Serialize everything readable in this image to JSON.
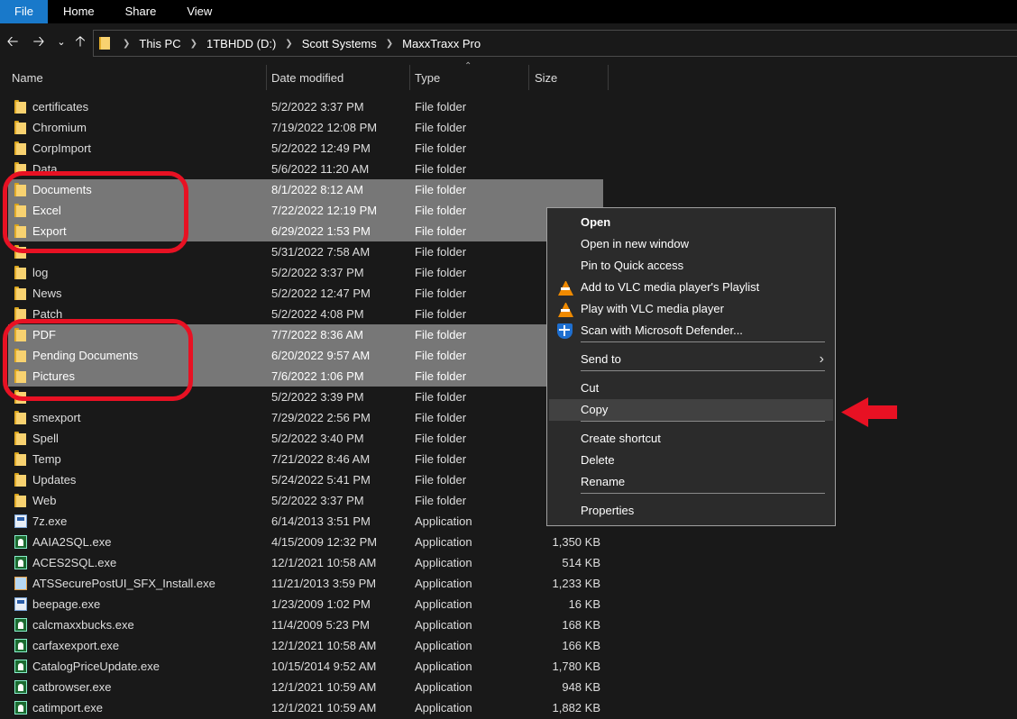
{
  "ribbon": {
    "tabs": [
      "File",
      "Home",
      "Share",
      "View"
    ]
  },
  "address": {
    "crumbs": [
      "This PC",
      "1TBHDD (D:)",
      "Scott Systems",
      "MaxxTraxx Pro"
    ]
  },
  "columns": {
    "name": "Name",
    "date": "Date modified",
    "type": "Type",
    "size": "Size"
  },
  "files": [
    {
      "name": "certificates",
      "date": "5/2/2022 3:37 PM",
      "type": "File folder",
      "size": "",
      "icon": "folder",
      "selected": false
    },
    {
      "name": "Chromium",
      "date": "7/19/2022 12:08 PM",
      "type": "File folder",
      "size": "",
      "icon": "folder",
      "selected": false
    },
    {
      "name": "CorpImport",
      "date": "5/2/2022 12:49 PM",
      "type": "File folder",
      "size": "",
      "icon": "folder",
      "selected": false
    },
    {
      "name": "Data",
      "date": "5/6/2022 11:20 AM",
      "type": "File folder",
      "size": "",
      "icon": "folder",
      "selected": false
    },
    {
      "name": "Documents",
      "date": "8/1/2022 8:12 AM",
      "type": "File folder",
      "size": "",
      "icon": "folder",
      "selected": true
    },
    {
      "name": "Excel",
      "date": "7/22/2022 12:19 PM",
      "type": "File folder",
      "size": "",
      "icon": "folder",
      "selected": true
    },
    {
      "name": "Export",
      "date": "6/29/2022 1:53 PM",
      "type": "File folder",
      "size": "",
      "icon": "folder",
      "selected": true
    },
    {
      "name": "",
      "date": "5/31/2022 7:58 AM",
      "type": "File folder",
      "size": "",
      "icon": "folder",
      "selected": false
    },
    {
      "name": "log",
      "date": "5/2/2022 3:37 PM",
      "type": "File folder",
      "size": "",
      "icon": "folder",
      "selected": false
    },
    {
      "name": "News",
      "date": "5/2/2022 12:47 PM",
      "type": "File folder",
      "size": "",
      "icon": "folder",
      "selected": false
    },
    {
      "name": "Patch",
      "date": "5/2/2022 4:08 PM",
      "type": "File folder",
      "size": "",
      "icon": "folder",
      "selected": false
    },
    {
      "name": "PDF",
      "date": "7/7/2022 8:36 AM",
      "type": "File folder",
      "size": "",
      "icon": "folder",
      "selected": true
    },
    {
      "name": "Pending Documents",
      "date": "6/20/2022 9:57 AM",
      "type": "File folder",
      "size": "",
      "icon": "folder",
      "selected": true
    },
    {
      "name": "Pictures",
      "date": "7/6/2022 1:06 PM",
      "type": "File folder",
      "size": "",
      "icon": "folder",
      "selected": true
    },
    {
      "name": "",
      "date": "5/2/2022 3:39 PM",
      "type": "File folder",
      "size": "",
      "icon": "folder",
      "selected": false
    },
    {
      "name": "smexport",
      "date": "7/29/2022 2:56 PM",
      "type": "File folder",
      "size": "",
      "icon": "folder",
      "selected": false
    },
    {
      "name": "Spell",
      "date": "5/2/2022 3:40 PM",
      "type": "File folder",
      "size": "",
      "icon": "folder",
      "selected": false
    },
    {
      "name": "Temp",
      "date": "7/21/2022 8:46 AM",
      "type": "File folder",
      "size": "",
      "icon": "folder",
      "selected": false
    },
    {
      "name": "Updates",
      "date": "5/24/2022 5:41 PM",
      "type": "File folder",
      "size": "",
      "icon": "folder",
      "selected": false
    },
    {
      "name": "Web",
      "date": "5/2/2022 3:37 PM",
      "type": "File folder",
      "size": "",
      "icon": "folder",
      "selected": false
    },
    {
      "name": "7z.exe",
      "date": "6/14/2013 3:51 PM",
      "type": "Application",
      "size": "",
      "icon": "exe-blue",
      "selected": false
    },
    {
      "name": "AAIA2SQL.exe",
      "date": "4/15/2009 12:32 PM",
      "type": "Application",
      "size": "1,350 KB",
      "icon": "exe-tree",
      "selected": false
    },
    {
      "name": "ACES2SQL.exe",
      "date": "12/1/2021 10:58 AM",
      "type": "Application",
      "size": "514 KB",
      "icon": "exe-tree",
      "selected": false
    },
    {
      "name": "ATSSecurePostUI_SFX_Install.exe",
      "date": "11/21/2013 3:59 PM",
      "type": "Application",
      "size": "1,233 KB",
      "icon": "exe-pkg",
      "selected": false
    },
    {
      "name": "beepage.exe",
      "date": "1/23/2009 1:02 PM",
      "type": "Application",
      "size": "16 KB",
      "icon": "exe-blue",
      "selected": false
    },
    {
      "name": "calcmaxxbucks.exe",
      "date": "11/4/2009 5:23 PM",
      "type": "Application",
      "size": "168 KB",
      "icon": "exe-tree",
      "selected": false
    },
    {
      "name": "carfaxexport.exe",
      "date": "12/1/2021 10:58 AM",
      "type": "Application",
      "size": "166 KB",
      "icon": "exe-tree",
      "selected": false
    },
    {
      "name": "CatalogPriceUpdate.exe",
      "date": "10/15/2014 9:52 AM",
      "type": "Application",
      "size": "1,780 KB",
      "icon": "exe-tree",
      "selected": false
    },
    {
      "name": "catbrowser.exe",
      "date": "12/1/2021 10:59 AM",
      "type": "Application",
      "size": "948 KB",
      "icon": "exe-tree",
      "selected": false
    },
    {
      "name": "catimport.exe",
      "date": "12/1/2021 10:59 AM",
      "type": "Application",
      "size": "1,882 KB",
      "icon": "exe-tree",
      "selected": false
    }
  ],
  "context_menu": {
    "items": [
      {
        "label": "Open",
        "bold": true,
        "icon": ""
      },
      {
        "label": "Open in new window",
        "icon": ""
      },
      {
        "label": "Pin to Quick access",
        "icon": ""
      },
      {
        "label": "Add to VLC media player's Playlist",
        "icon": "vlc-icon"
      },
      {
        "label": "Play with VLC media player",
        "icon": "vlc-icon"
      },
      {
        "label": "Scan with Microsoft Defender...",
        "icon": "defender-shield-icon"
      },
      {
        "label": "Send to",
        "icon": "",
        "submenu": true
      },
      {
        "label": "Cut",
        "icon": ""
      },
      {
        "label": "Copy",
        "icon": "",
        "hover": true
      },
      {
        "label": "Create shortcut",
        "icon": ""
      },
      {
        "label": "Delete",
        "icon": ""
      },
      {
        "label": "Rename",
        "icon": ""
      },
      {
        "label": "Properties",
        "icon": ""
      }
    ]
  },
  "colors": {
    "accent": "#1979ca",
    "annotation": "#e81123",
    "selection": "#777777",
    "menu_bg": "#2b2b2b"
  }
}
